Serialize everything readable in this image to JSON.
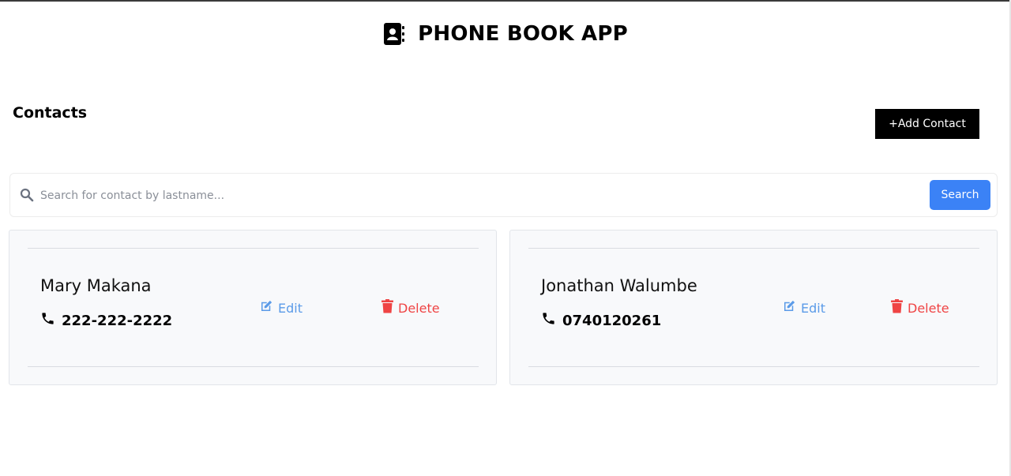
{
  "header": {
    "title": "PHONE BOOK APP",
    "logo_icon": "contact-book-icon"
  },
  "contacts_section": {
    "title": "Contacts",
    "add_button_label": "+Add Contact"
  },
  "search": {
    "placeholder": "Search for contact by lastname...",
    "value": "",
    "button_label": "Search",
    "icon": "search-icon"
  },
  "contacts": [
    {
      "name": "Mary Makana",
      "phone": "222-222-2222",
      "edit_label": "Edit",
      "delete_label": "Delete"
    },
    {
      "name": "Jonathan Walumbe",
      "phone": "0740120261",
      "edit_label": "Edit",
      "delete_label": "Delete"
    }
  ],
  "colors": {
    "accent_blue": "#3b82f6",
    "edit_blue": "#5b9be8",
    "delete_red": "#ef4444",
    "card_bg": "#f8f9fb"
  }
}
